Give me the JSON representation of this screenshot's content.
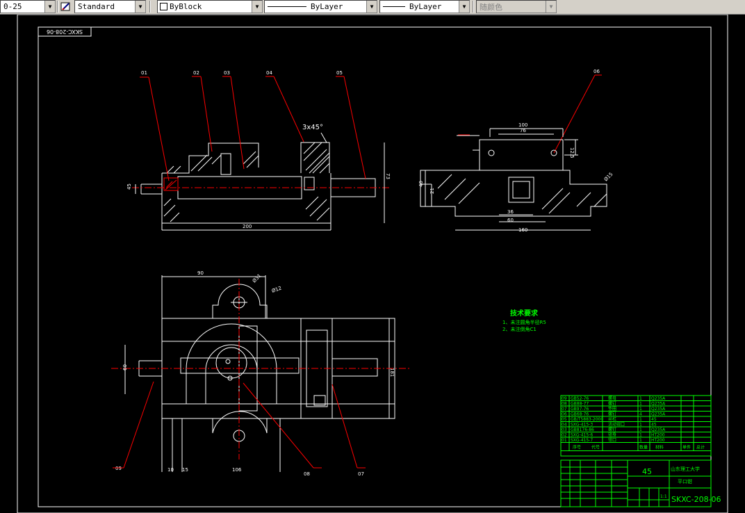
{
  "toolbar": {
    "dimstyle_value": "0-25",
    "textstyle_value": "Standard",
    "color_value": "ByBlock",
    "linetype_value": "ByLayer",
    "lineweight_value": "ByLayer",
    "plotstyle_value": "随颜色",
    "style_icon": "text-style-icon",
    "dropdown_icon": "chevron-down-icon"
  },
  "drawing": {
    "title_block_code": "SKXC-208-06",
    "mirrored_code": "SKXC-208-06",
    "part_labels": [
      "01",
      "02",
      "03",
      "04",
      "05",
      "06",
      "07",
      "08",
      "09"
    ],
    "chamfer_note": "3x45°",
    "dims_front": {
      "height": "73",
      "dia": "45",
      "length": "200"
    },
    "dims_side": {
      "top_width": "100",
      "inner_width": "76",
      "hole_h": "12.5",
      "left_h": "40",
      "left_small": "21",
      "bottom_36": "36",
      "bottom_60": "60",
      "total": "160",
      "dia_right": "Ø15"
    },
    "dims_plan": {
      "width_90": "90",
      "dia_31": "Ø31",
      "dia_12": "Ø12",
      "left_60": "60",
      "right_181": "181",
      "b10": "10",
      "b15": "15",
      "b106": "106"
    },
    "tech_req": {
      "title": "技术要求",
      "line1": "1、未注圆角半径R5",
      "line2": "2、未注倒角C1"
    },
    "bom": [
      {
        "no": "09",
        "code": "GB52-76",
        "name": "螺母",
        "qty": "1",
        "mat": "Q235A"
      },
      {
        "no": "08",
        "code": "GB88-77",
        "name": "螺钉",
        "qty": "1",
        "mat": "Q235A"
      },
      {
        "no": "07",
        "code": "GB97-76",
        "name": "垫圈",
        "qty": "1",
        "mat": "Q235A"
      },
      {
        "no": "06",
        "code": "GB68-76",
        "name": "螺钉",
        "qty": "4",
        "mat": "Q235A"
      },
      {
        "no": "05",
        "code": "GB/T5883-2000",
        "name": "丝杠",
        "qty": "1",
        "mat": "45"
      },
      {
        "no": "04",
        "code": "SXG-415-3",
        "name": "活动钳口",
        "qty": "1",
        "mat": "45"
      },
      {
        "no": "03",
        "code": "GB8176-86",
        "name": "螺钉",
        "qty": "1",
        "mat": "Q235A"
      },
      {
        "no": "02",
        "code": "SXG-415-6",
        "name": "钳身",
        "qty": "1",
        "mat": "HT200"
      },
      {
        "no": "01",
        "code": "SXG-415-7",
        "name": "钳口",
        "qty": "1",
        "mat": "HT200"
      }
    ],
    "bom_header": {
      "no": "序号",
      "code": "代号",
      "qty": "数量",
      "mat": "材料",
      "weight": "单件",
      "total": "总计"
    },
    "title_block": {
      "material": "45",
      "school": "山东理工大学",
      "part_name": "平口钳",
      "scale": "1:1"
    },
    "colors": {
      "white": "#ffffff",
      "red": "#ff0000",
      "green": "#00ff00",
      "cyan": "#00ffff",
      "yellow": "#ffff00"
    }
  }
}
